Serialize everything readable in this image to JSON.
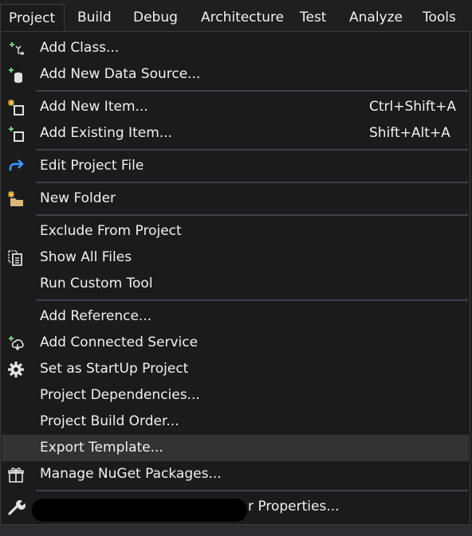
{
  "menubar": {
    "items": [
      {
        "label": "Project",
        "active": true
      },
      {
        "label": "Build"
      },
      {
        "label": "Debug"
      },
      {
        "label": "Architecture"
      },
      {
        "label": "Test"
      },
      {
        "label": "Analyze"
      },
      {
        "label": "Tools"
      }
    ]
  },
  "menu": {
    "items": [
      {
        "label": "Add Class...",
        "icon": "add-class-icon"
      },
      {
        "label": "Add New Data Source...",
        "icon": "add-data-source-icon"
      },
      {
        "label": "Add New Item...",
        "shortcut": "Ctrl+Shift+A",
        "icon": "add-new-item-icon"
      },
      {
        "label": "Add Existing Item...",
        "shortcut": "Shift+Alt+A",
        "icon": "add-existing-item-icon"
      },
      {
        "label": "Edit Project File",
        "icon": "edit-project-file-icon"
      },
      {
        "label": "New Folder",
        "icon": "new-folder-icon"
      },
      {
        "label": "Exclude From Project"
      },
      {
        "label": "Show All Files",
        "icon": "show-all-files-icon"
      },
      {
        "label": "Run Custom Tool"
      },
      {
        "label": "Add Reference..."
      },
      {
        "label": "Add Connected Service",
        "icon": "connected-service-icon"
      },
      {
        "label": "Set as StartUp Project",
        "icon": "gear-icon"
      },
      {
        "label": "Project Dependencies..."
      },
      {
        "label": "Project Build Order..."
      },
      {
        "label": "Export Template...",
        "highlighted": true
      },
      {
        "label": "Manage NuGet Packages...",
        "icon": "nuget-package-icon"
      },
      {
        "label": "r Properties...",
        "icon": "wrench-icon",
        "redacted_prefix": true
      }
    ]
  },
  "colors": {
    "background": "#1f1f1f",
    "menu_background": "#1b1b1c",
    "highlight": "#333334",
    "separator": "#3f3f46",
    "text": "#f1f1f1",
    "accent_green": "#71d071",
    "accent_yellow": "#f4c142",
    "accent_blue": "#3b9cff"
  }
}
